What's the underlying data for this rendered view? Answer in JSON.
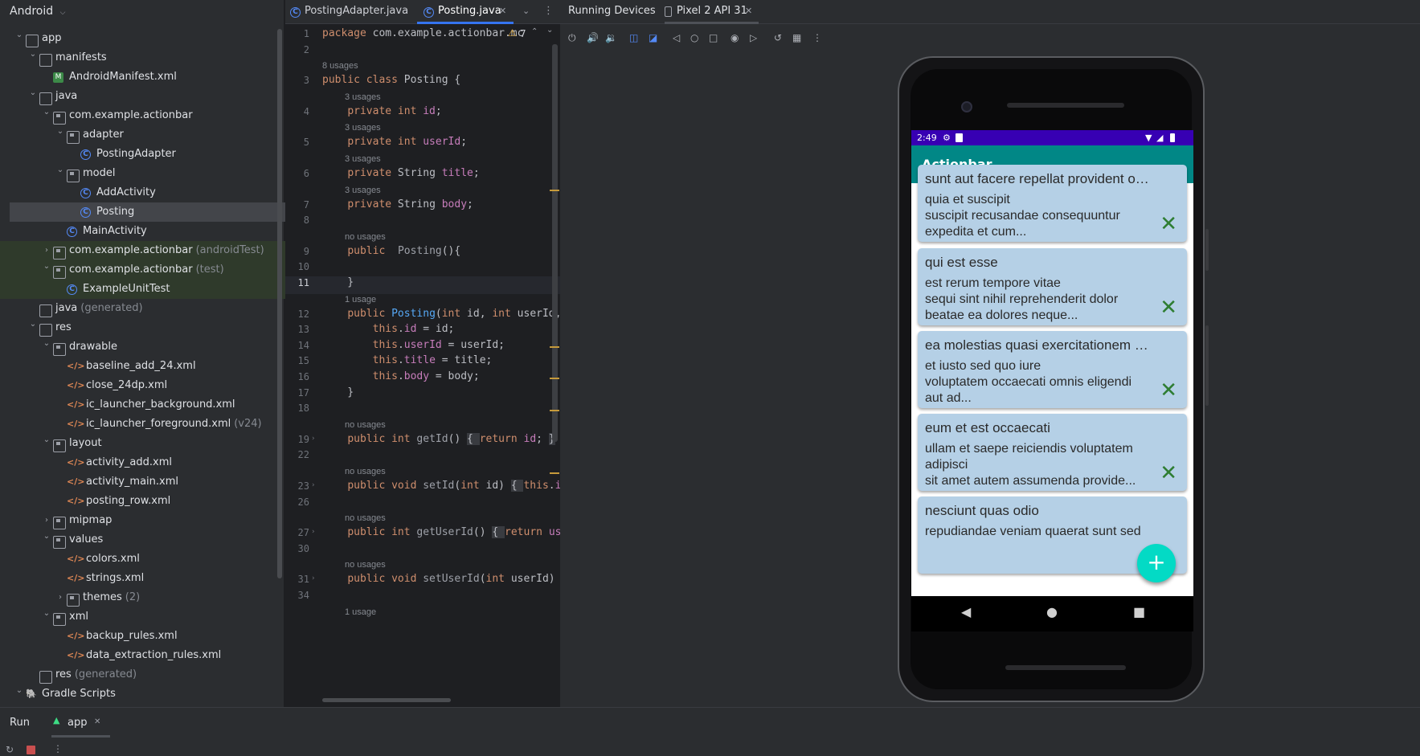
{
  "project_panel": {
    "view_selector": "Android",
    "tree": [
      {
        "indent": 0,
        "chev": "v",
        "icon": "module",
        "label": "app",
        "suffix": ""
      },
      {
        "indent": 1,
        "chev": "v",
        "icon": "folder",
        "label": "manifests",
        "suffix": ""
      },
      {
        "indent": 2,
        "chev": "",
        "icon": "manifest",
        "label": "AndroidManifest.xml",
        "suffix": ""
      },
      {
        "indent": 1,
        "chev": "v",
        "icon": "folder",
        "label": "java",
        "suffix": ""
      },
      {
        "indent": 2,
        "chev": "v",
        "icon": "package",
        "label": "com.example.actionbar",
        "suffix": ""
      },
      {
        "indent": 3,
        "chev": "v",
        "icon": "package",
        "label": "adapter",
        "suffix": ""
      },
      {
        "indent": 4,
        "chev": "",
        "icon": "class",
        "label": "PostingAdapter",
        "suffix": ""
      },
      {
        "indent": 3,
        "chev": "v",
        "icon": "package",
        "label": "model",
        "suffix": ""
      },
      {
        "indent": 4,
        "chev": "",
        "icon": "class",
        "label": "AddActivity",
        "suffix": ""
      },
      {
        "indent": 4,
        "chev": "",
        "icon": "class",
        "label": "Posting",
        "suffix": "",
        "selected": true
      },
      {
        "indent": 3,
        "chev": "",
        "icon": "class",
        "label": "MainActivity",
        "suffix": ""
      },
      {
        "indent": 2,
        "chev": ">",
        "icon": "package",
        "label": "com.example.actionbar",
        "suffix": "(androidTest)",
        "green": true
      },
      {
        "indent": 2,
        "chev": "v",
        "icon": "package",
        "label": "com.example.actionbar",
        "suffix": "(test)",
        "green": true
      },
      {
        "indent": 3,
        "chev": "",
        "icon": "class",
        "label": "ExampleUnitTest",
        "suffix": "",
        "green": true
      },
      {
        "indent": 1,
        "chev": "",
        "icon": "folder",
        "label": "java",
        "suffix": "(generated)"
      },
      {
        "indent": 1,
        "chev": "v",
        "icon": "folder",
        "label": "res",
        "suffix": ""
      },
      {
        "indent": 2,
        "chev": "v",
        "icon": "package",
        "label": "drawable",
        "suffix": ""
      },
      {
        "indent": 3,
        "chev": "",
        "icon": "xml",
        "label": "baseline_add_24.xml",
        "suffix": ""
      },
      {
        "indent": 3,
        "chev": "",
        "icon": "xml",
        "label": "close_24dp.xml",
        "suffix": ""
      },
      {
        "indent": 3,
        "chev": "",
        "icon": "xml",
        "label": "ic_launcher_background.xml",
        "suffix": ""
      },
      {
        "indent": 3,
        "chev": "",
        "icon": "xml",
        "label": "ic_launcher_foreground.xml",
        "suffix": "(v24)"
      },
      {
        "indent": 2,
        "chev": "v",
        "icon": "package",
        "label": "layout",
        "suffix": ""
      },
      {
        "indent": 3,
        "chev": "",
        "icon": "xml",
        "label": "activity_add.xml",
        "suffix": ""
      },
      {
        "indent": 3,
        "chev": "",
        "icon": "xml",
        "label": "activity_main.xml",
        "suffix": ""
      },
      {
        "indent": 3,
        "chev": "",
        "icon": "xml",
        "label": "posting_row.xml",
        "suffix": ""
      },
      {
        "indent": 2,
        "chev": ">",
        "icon": "package",
        "label": "mipmap",
        "suffix": ""
      },
      {
        "indent": 2,
        "chev": "v",
        "icon": "package",
        "label": "values",
        "suffix": ""
      },
      {
        "indent": 3,
        "chev": "",
        "icon": "xml",
        "label": "colors.xml",
        "suffix": ""
      },
      {
        "indent": 3,
        "chev": "",
        "icon": "xml",
        "label": "strings.xml",
        "suffix": ""
      },
      {
        "indent": 3,
        "chev": ">",
        "icon": "package",
        "label": "themes",
        "suffix": "(2)"
      },
      {
        "indent": 2,
        "chev": "v",
        "icon": "package",
        "label": "xml",
        "suffix": ""
      },
      {
        "indent": 3,
        "chev": "",
        "icon": "xml",
        "label": "backup_rules.xml",
        "suffix": ""
      },
      {
        "indent": 3,
        "chev": "",
        "icon": "xml",
        "label": "data_extraction_rules.xml",
        "suffix": ""
      },
      {
        "indent": 1,
        "chev": "",
        "icon": "folder",
        "label": "res",
        "suffix": "(generated)"
      },
      {
        "indent": 0,
        "chev": "v",
        "icon": "gradle",
        "label": "Gradle Scripts",
        "suffix": ""
      }
    ]
  },
  "editor": {
    "tabs": [
      {
        "label": "PostingAdapter.java",
        "active": false
      },
      {
        "label": "Posting.java",
        "active": true
      }
    ],
    "warning_count": "7",
    "lines": [
      {
        "n": "1",
        "hint": "",
        "html": "<span class='kw'>package</span> com.example.actionbar.mc"
      },
      {
        "n": "2",
        "hint": "",
        "html": ""
      },
      {
        "n": "3",
        "hint": "8 usages",
        "html": "<span class='kw'>public class</span> Posting {"
      },
      {
        "n": "4",
        "hint": "3 usages",
        "html": "    <span class='kw'>private int</span> <span class='fld'>id</span>;"
      },
      {
        "n": "5",
        "hint": "3 usages",
        "html": "    <span class='kw'>private int</span> <span class='fld'>userId</span>;"
      },
      {
        "n": "6",
        "hint": "3 usages",
        "html": "    <span class='kw'>private</span> String <span class='fld'>title</span>;"
      },
      {
        "n": "7",
        "hint": "3 usages",
        "html": "    <span class='kw'>private</span> String <span class='fld'>body</span>;"
      },
      {
        "n": "8",
        "hint": "",
        "html": ""
      },
      {
        "n": "9",
        "hint": "no usages",
        "html": "    <span class='kw'>public</span>  <span style='color:#9da0a8'>Posting</span>(){"
      },
      {
        "n": "10",
        "hint": "",
        "html": ""
      },
      {
        "n": "11",
        "hint": "",
        "html": "    }"
      },
      {
        "n": "12",
        "hint": "1 usage",
        "html": "    <span class='kw'>public</span> <span class='fn'>Posting</span>(<span class='kw'>int</span> id, <span class='kw'>int</span> userId, St"
      },
      {
        "n": "13",
        "hint": "",
        "html": "        <span class='kw'>this</span>.<span class='fld'>id</span> = id;"
      },
      {
        "n": "14",
        "hint": "",
        "html": "        <span class='kw'>this</span>.<span class='fld'>userId</span> = userId;"
      },
      {
        "n": "15",
        "hint": "",
        "html": "        <span class='kw'>this</span>.<span class='fld'>title</span> = title;"
      },
      {
        "n": "16",
        "hint": "",
        "html": "        <span class='kw'>this</span>.<span class='fld'>body</span> = body;"
      },
      {
        "n": "17",
        "hint": "",
        "html": "    }"
      },
      {
        "n": "18",
        "hint": "",
        "html": ""
      },
      {
        "n": "19",
        "hint": "no usages",
        "html": "    <span class='kw'>public int</span> <span style='color:#9da0a8'>getId</span>() <span style='background:#393b40'>{ </span><span class='kw'>return</span> <span class='fld'>id</span>; <span style='background:#393b40'>}</span>"
      },
      {
        "n": "22",
        "hint": "",
        "html": ""
      },
      {
        "n": "23",
        "hint": "no usages",
        "html": "    <span class='kw'>public void</span> <span style='color:#9da0a8'>setId</span>(<span class='kw'>int</span> id) <span style='background:#393b40'>{ </span><span class='kw'>this</span>.<span class='fld'>id</span> ="
      },
      {
        "n": "26",
        "hint": "",
        "html": ""
      },
      {
        "n": "27",
        "hint": "no usages",
        "html": "    <span class='kw'>public int</span> <span style='color:#9da0a8'>getUserId</span>() <span style='background:#393b40'>{ </span><span class='kw'>return</span> <span class='fld'>userI</span>"
      },
      {
        "n": "30",
        "hint": "",
        "html": ""
      },
      {
        "n": "31",
        "hint": "no usages",
        "html": "    <span class='kw'>public void</span> <span style='color:#9da0a8'>setUserId</span>(<span class='kw'>int</span> userId) <span style='background:#393b40'>{ </span><span class='kw'>th</span>"
      },
      {
        "n": "34",
        "hint": "",
        "html": ""
      },
      {
        "n": "",
        "hint": "1 usage",
        "html": ""
      }
    ]
  },
  "running_devices": {
    "title": "Running Devices",
    "device_tab": "Pixel 2 API 31",
    "toolbar_icons": [
      "power-icon",
      "volume-up-icon",
      "volume-down-icon",
      "rotate-left-icon",
      "rotate-right-icon",
      "back-icon",
      "home-icon",
      "overview-icon",
      "screenshot-icon",
      "screen-record-icon",
      "reset-icon",
      "snapshot-icon",
      "more-icon"
    ]
  },
  "phone": {
    "status_time": "2:49",
    "app_title": "Actionbar",
    "posts": [
      {
        "title": "sunt aut facere repellat provident occaecati excepturi optio reprehenderit",
        "body": "quia et suscipit\nsuscipit recusandae consequuntur\nexpedita et cum..."
      },
      {
        "title": "qui est esse",
        "body": "est rerum tempore vitae\nsequi sint nihil reprehenderit dolor\nbeatae ea dolores neque..."
      },
      {
        "title": "ea molestias quasi exercitationem repellat qui ipsa sit aut",
        "body": "et iusto sed quo iure\nvoluptatem occaecati omnis eligendi\naut ad..."
      },
      {
        "title": "eum et est occaecati",
        "body": "ullam et saepe reiciendis voluptatem\nadipisci\nsit amet autem assumenda provide..."
      },
      {
        "title": "nesciunt quas odio",
        "body": "repudiandae veniam quaerat sunt sed"
      }
    ],
    "fab_label": "+",
    "delete_glyph": "✕"
  },
  "bottom_bar": {
    "run_label": "Run",
    "app_tab": "app"
  },
  "colors": {
    "status_bar": "#3700b3",
    "app_bar": "#018786",
    "card": "#b5d0e6",
    "fab": "#03dac5",
    "delete": "#2e7d32"
  }
}
